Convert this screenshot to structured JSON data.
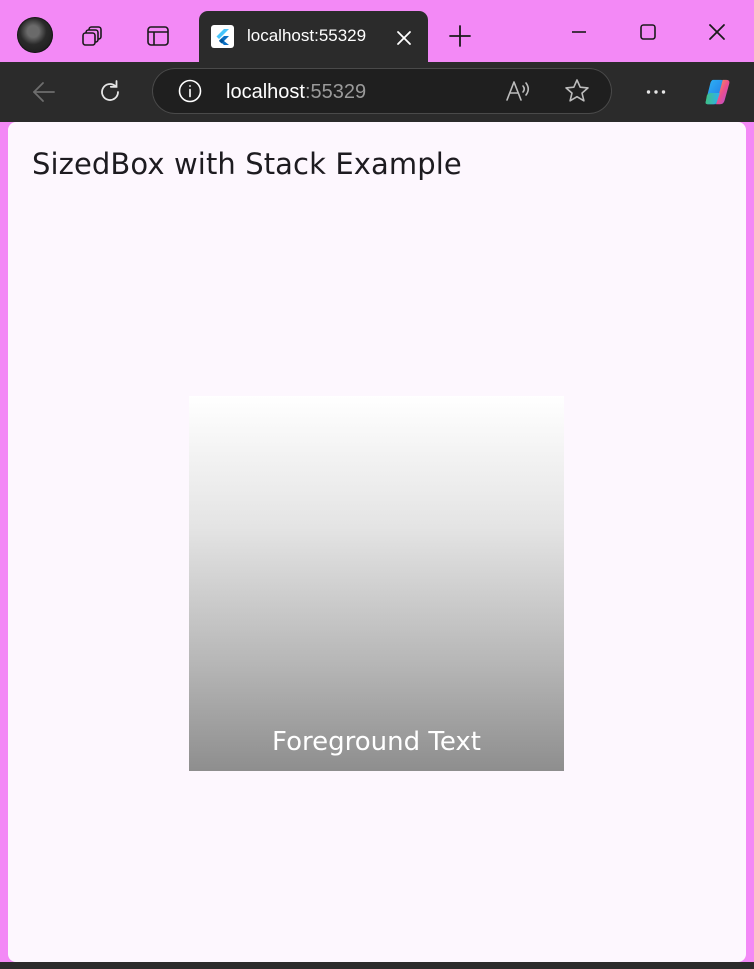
{
  "tab": {
    "title": "localhost:55329"
  },
  "address_bar": {
    "host": "localhost",
    "port": ":55329"
  },
  "page": {
    "title": "SizedBox with Stack Example",
    "foreground_text": "Foreground Text"
  },
  "colors": {
    "tabstrip": "#f389f6",
    "toolbar": "#2b2b2b",
    "page_background": "#fdf7fe",
    "gradient_top": "#ffffff",
    "gradient_bottom": "#8e8e8e"
  },
  "icons": {
    "strip": [
      "profile-avatar",
      "workspaces-icon",
      "vertical-tabs-icon"
    ],
    "tab": [
      "flutter-favicon",
      "close-tab-icon"
    ],
    "toolbar": [
      "back-icon",
      "refresh-icon",
      "site-info-icon",
      "read-aloud-icon",
      "favorite-star-icon",
      "more-menu-icon",
      "copilot-icon"
    ],
    "window": [
      "minimize-icon",
      "maximize-icon",
      "close-window-icon"
    ]
  }
}
